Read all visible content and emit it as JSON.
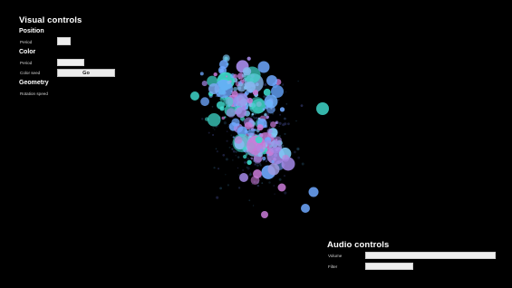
{
  "visual_controls": {
    "title": "Visual controls",
    "position": {
      "heading": "Position",
      "period_label": "Period"
    },
    "color": {
      "heading": "Color",
      "period_label": "Period",
      "seed_label": "Color seed",
      "go_label": "Go"
    },
    "geometry": {
      "heading": "Geometry",
      "rotation_label": "Rotation speed"
    }
  },
  "audio_controls": {
    "title": "Audio controls",
    "volume_label": "Volume",
    "filter_label": "Filter"
  },
  "colors": {
    "background": "#000000",
    "particle_blue": "#6fa8ff",
    "particle_cyan": "#3ed6c9",
    "particle_violet": "#a58ae8",
    "particle_pink": "#c97bd8"
  }
}
